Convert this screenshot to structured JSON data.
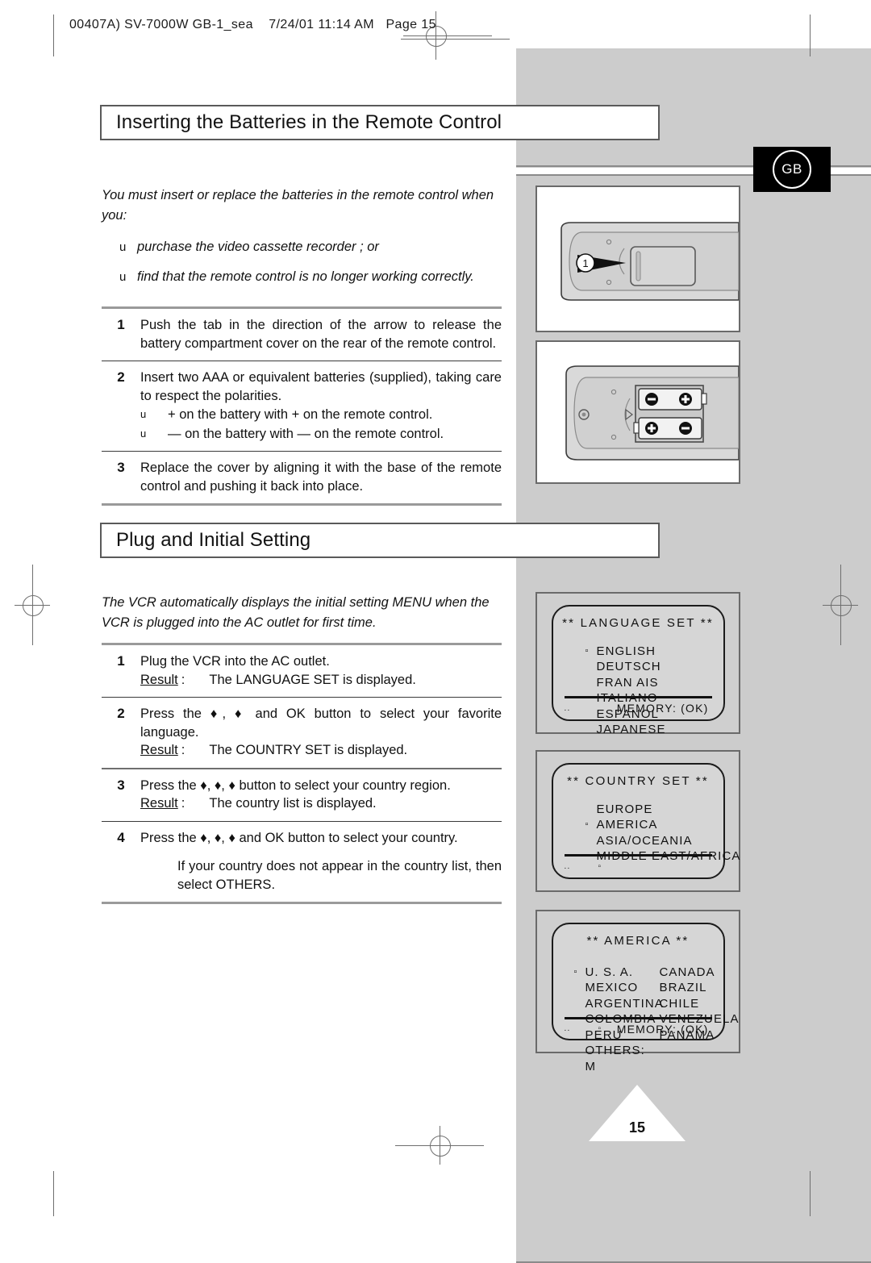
{
  "slug": {
    "text": "00407A) SV-7000W GB-1_sea    7/24/01 11:14 AM   Page 15"
  },
  "badge": {
    "label": "GB"
  },
  "page": {
    "number": "15"
  },
  "sections": [
    {
      "title": "Inserting the Batteries in the Remote Control",
      "lead": {
        "intro": "You must insert or replace the batteries in the remote control when you:",
        "bullet_marker": "u",
        "bullets": [
          "purchase the video cassette recorder ; or",
          "find that the remote control is no longer working correctly."
        ]
      },
      "steps": [
        {
          "num": "1",
          "text": "Push the tab in the direction of the arrow to release the battery compartment cover on the rear of the remote control."
        },
        {
          "num": "2",
          "text": "Insert two AAA or equivalent batteries (supplied), taking care to respect the polarities.",
          "subs": [
            "+ on the battery with + on the remote control.",
            "— on the battery with — on the remote control."
          ]
        },
        {
          "num": "3",
          "text": "Replace the cover by aligning it with the base of the remote control and pushing it back into place."
        }
      ]
    },
    {
      "title": "Plug and Initial Setting",
      "lead": {
        "intro": "The VCR automatically displays the initial setting MENU when the VCR is plugged into the AC outlet for first time."
      },
      "steps": [
        {
          "num": "1",
          "text": "Plug the VCR into the AC outlet.",
          "result_label": "Result",
          "result_colon": ":",
          "result_text": "The LANGUAGE SET is displayed."
        },
        {
          "num": "2",
          "text": "Press the ♦, ♦ and OK button to select your favorite language.",
          "result_label": "Result",
          "result_colon": ":",
          "result_text": "The COUNTRY SET is displayed."
        },
        {
          "num": "3",
          "text": "Press the ♦, ♦, ♦ button to select your country region.",
          "result_label": "Result",
          "result_colon": ":",
          "result_text": "The country list is displayed."
        },
        {
          "num": "4",
          "text": "Press the ♦, ♦, ♦ and OK button to select your country.",
          "note": "If your country does not appear in the country list, then select OTHERS."
        }
      ]
    }
  ],
  "figures": [
    {
      "name": "remote-back-tab",
      "callout": "1"
    },
    {
      "name": "remote-battery-compartment"
    }
  ],
  "osd": [
    {
      "title": "**  LANGUAGE SET  **",
      "cursor_index": 0,
      "items": [
        "ENGLISH",
        "DEUTSCH",
        "FRAN AIS",
        "ITALIANO",
        "ESPANOL",
        "JAPANESE"
      ],
      "footer_left": "..",
      "footer_mid": "",
      "footer_right": "MEMORY: (OK)"
    },
    {
      "title": "**  COUNTRY SET  **",
      "cursor_index": 1,
      "items": [
        "EUROPE",
        "AMERICA",
        "ASIA/OCEANIA",
        "MIDDLE EAST/AFRICA"
      ],
      "footer_left": "..",
      "footer_mid": "▫",
      "footer_right": ""
    },
    {
      "title": "**  AMERICA  **",
      "cursor_index": 0,
      "columns": [
        {
          "left": "U. S. A.",
          "right": "CANADA"
        },
        {
          "left": "MEXICO",
          "right": "BRAZIL"
        },
        {
          "left": "ARGENTINA",
          "right": "CHILE"
        },
        {
          "left": "COLOMBIA",
          "right": "VENEZUELA"
        },
        {
          "left": "PERU",
          "right": "PANAMA"
        },
        {
          "left": "OTHERS: M",
          "right": ""
        }
      ],
      "footer_left": "..",
      "footer_mid": "▫",
      "footer_right": "MEMORY: (OK)"
    }
  ],
  "colors": {
    "band": "#cccccc",
    "rule": "#6e6e6e",
    "badge_bg": "#000000",
    "osd_screen": "#d6d6d6"
  }
}
